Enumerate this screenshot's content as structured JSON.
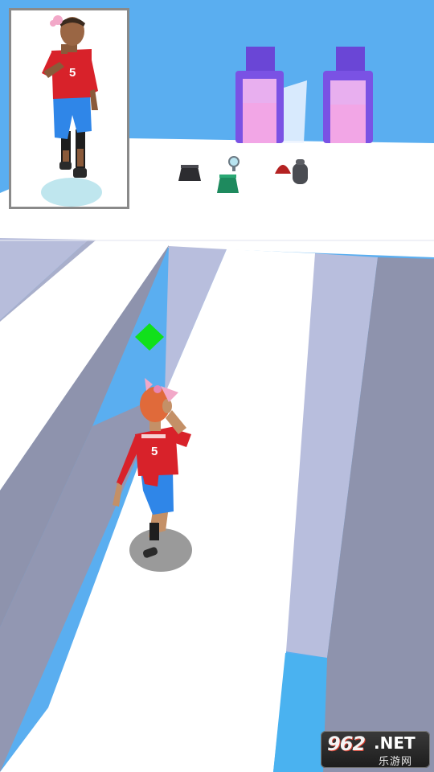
{
  "game": {
    "player": {
      "jersey_number": "5"
    },
    "preview_model": {
      "jersey_number": "5"
    },
    "collectibles": [
      {
        "name": "black-skirt"
      },
      {
        "name": "hand-mirror"
      },
      {
        "name": "green-skirt"
      },
      {
        "name": "red-beanie-hat"
      },
      {
        "name": "grey-backpack"
      }
    ],
    "gates": [
      {
        "name": "left-pink-gate"
      },
      {
        "name": "right-pink-gate"
      }
    ],
    "marker": {
      "name": "green-diamond-gem",
      "color": "#11e01b"
    }
  },
  "watermark": {
    "number": "962",
    "suffix": ".NET",
    "chinese": "乐游网"
  },
  "colors": {
    "sky": "#5aaef0",
    "track": "#ffffff",
    "track_shadow": "#b8bedd",
    "wall": "#8e93ad",
    "gate_frame": "#6a46d6",
    "gate_glow": "#f5a8e4",
    "jersey": "#d8222a",
    "shorts": "#2f86e8"
  }
}
